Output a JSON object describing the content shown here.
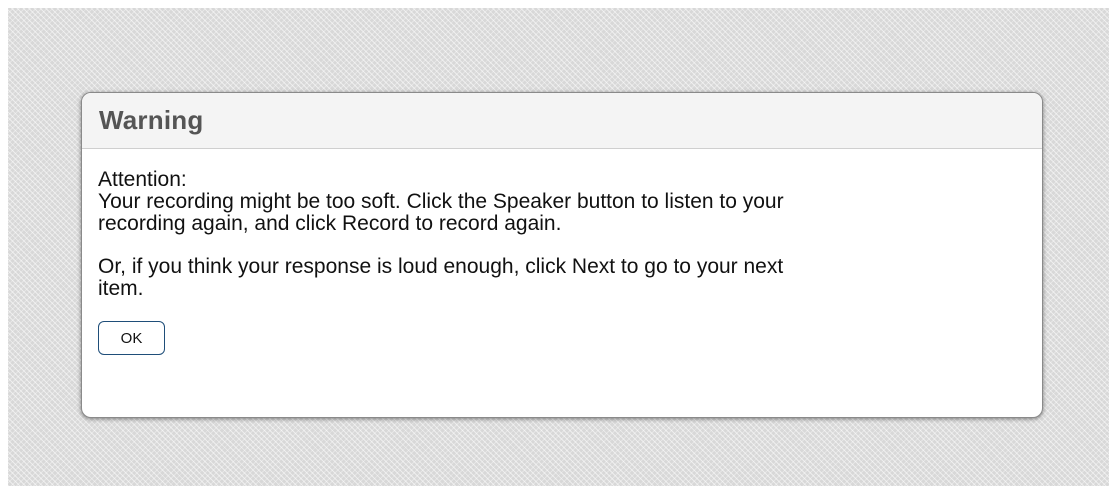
{
  "dialog": {
    "title": "Warning",
    "message": {
      "heading": "Attention:",
      "line1": "Your recording might be too soft. Click the Speaker button to listen to your",
      "line2": "recording again, and click Record to record again.",
      "line3": "Or, if you think your response is loud enough, click Next to go to your next",
      "line4": "item."
    },
    "ok_label": "OK"
  }
}
